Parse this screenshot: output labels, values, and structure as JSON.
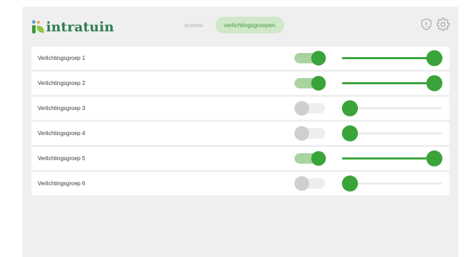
{
  "app": {
    "logo_text": "intratuin"
  },
  "tabs": [
    {
      "label": "scenes",
      "active": false
    },
    {
      "label": "verlichtingsgroepen",
      "active": true
    }
  ],
  "header_icons": [
    "shield-alert-icon",
    "gear-icon"
  ],
  "groups": [
    {
      "name": "Verlichtingsgroep 1",
      "on": true,
      "level": 1.0
    },
    {
      "name": "Verlichtingsgroep 2",
      "on": true,
      "level": 1.0
    },
    {
      "name": "Verlichtingsgroep 3",
      "on": false,
      "level": 0.0
    },
    {
      "name": "Verlichtingsgroep 4",
      "on": false,
      "level": 0.0
    },
    {
      "name": "Verlichtingsgroep 5",
      "on": true,
      "level": 1.0
    },
    {
      "name": "Verlichtingsgroep 6",
      "on": false,
      "level": 0.0
    }
  ],
  "colors": {
    "accent": "#3aa33a",
    "accent_light": "#a9d4a0",
    "tab_active_bg": "#cfe8c8",
    "logo_text": "#2e7d4f",
    "background": "#efefef"
  }
}
